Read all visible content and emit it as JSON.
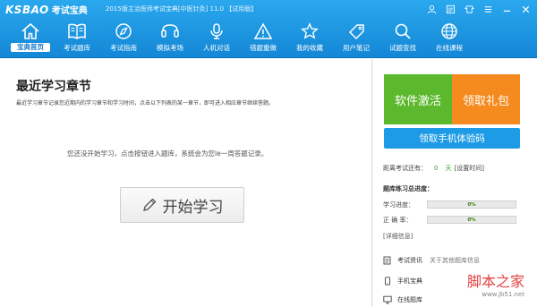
{
  "app": {
    "logo": "KSBAO",
    "logo_tag": "考试宝典",
    "title": "2015版主治医师考试宝典[中医针灸] 11.0 【试用版】"
  },
  "window_controls": [
    {
      "name": "user-icon"
    },
    {
      "name": "message-icon"
    },
    {
      "name": "skin-icon"
    },
    {
      "name": "menu-icon"
    },
    {
      "name": "minimize-icon"
    },
    {
      "name": "close-icon"
    }
  ],
  "nav": [
    {
      "label": "宝典首页",
      "icon": "home-icon",
      "active": true
    },
    {
      "label": "考试题库",
      "icon": "book-icon",
      "active": false
    },
    {
      "label": "考试指南",
      "icon": "guide-icon",
      "active": false
    },
    {
      "label": "模拟考场",
      "icon": "exam-room-icon",
      "active": false
    },
    {
      "label": "人机对话",
      "icon": "microphone-icon",
      "active": false
    },
    {
      "label": "错题重做",
      "icon": "mistake-icon",
      "active": false
    },
    {
      "label": "我的收藏",
      "icon": "star-icon",
      "active": false
    },
    {
      "label": "用户笔记",
      "icon": "note-icon",
      "active": false
    },
    {
      "label": "试题查找",
      "icon": "search-icon",
      "active": false
    },
    {
      "label": "在线课程",
      "icon": "globe-icon",
      "active": false
    }
  ],
  "main": {
    "heading": "最近学习章节",
    "description": "最近学习章节记录您近期内的学习章节和学习时间，点击以下列表的某一章节，即可进入相应章节继续答题。",
    "empty_message": "您还没开始学习，点击按钮进入题库，系统会为您le一周答题记录。",
    "start_button": "开始学习"
  },
  "side": {
    "activate_label": "软件激活",
    "gift_label": "领取礼包",
    "verify_label": "领取手机体验码",
    "exam_days_prefix": "距离考试还有：",
    "exam_days_value": "0",
    "exam_days_unit": "天",
    "exam_days_link": "[设置时间]",
    "progress_title": "题库练习总进度：",
    "progress": [
      {
        "label": "学习进度：",
        "value": 0,
        "text": "0%"
      },
      {
        "label": "正  确  率：",
        "value": 0,
        "text": "0%"
      }
    ],
    "detail_link": "[详细信息]",
    "info": [
      {
        "label": "考试资讯",
        "sub": "关于其他题库信息",
        "icon": "news-icon"
      },
      {
        "label": "手机宝典",
        "sub": "",
        "icon": "phone-icon"
      },
      {
        "label": "在线题库",
        "sub": "",
        "icon": "monitor-icon"
      }
    ],
    "watermark": "脚本之家",
    "watermark_url": "www.jb51.net"
  }
}
